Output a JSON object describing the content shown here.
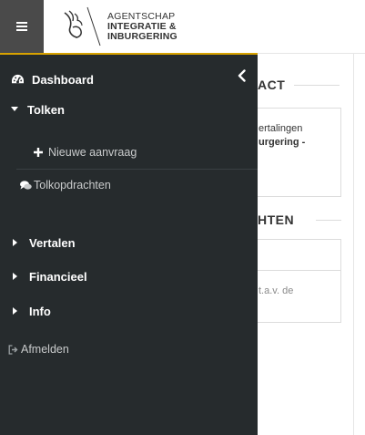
{
  "header": {
    "menu_icon": "hamburger-icon",
    "logo": {
      "line1": "AGENTSCHAP",
      "line2": "INTEGRATIE &",
      "line3": "INBURGERING"
    }
  },
  "background": {
    "section1_heading": "ACT",
    "card1_line1": "ertalingen",
    "card1_line2": "urgering -",
    "section2_heading": "HTEN",
    "card2_line": "t.a.v. de"
  },
  "drawer": {
    "accent": "#d7a200",
    "background": "#262b2d",
    "dashboard": {
      "label": "Dashboard",
      "icon": "tachometer-icon"
    },
    "close_icon": "chevron-left-icon",
    "tolken": {
      "label": "Tolken",
      "icon": "caret-down-icon"
    },
    "nieuwe_aanvraag": {
      "label": "Nieuwe aanvraag",
      "icon": "plus-icon"
    },
    "tolkopdrachten": {
      "label": "Tolkopdrachten",
      "icon": "comments-icon"
    },
    "vertalen": {
      "label": "Vertalen",
      "icon": "caret-right-icon"
    },
    "financieel": {
      "label": "Financieel",
      "icon": "caret-right-icon"
    },
    "info": {
      "label": "Info",
      "icon": "caret-right-icon"
    },
    "afmelden": {
      "label": "Afmelden",
      "icon": "sign-out-icon"
    }
  }
}
